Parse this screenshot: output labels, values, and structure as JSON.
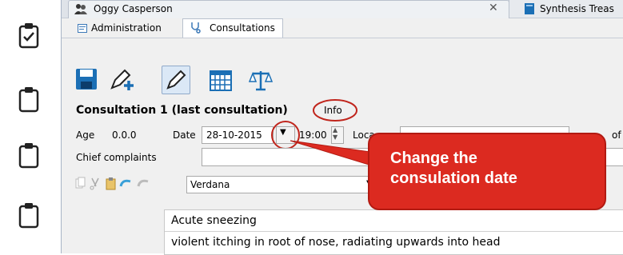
{
  "tabs": {
    "patient": "Oggy Casperson",
    "other": "Synthesis Treas"
  },
  "subtabs": {
    "administration": "Administration",
    "consultations": "Consultations"
  },
  "consultation": {
    "title": "Consultation 1 (last consultation)",
    "info": "Info"
  },
  "fields": {
    "age_label": "Age",
    "age_value": "0.0.0",
    "date_label": "Date",
    "date_value": "28-10-2015",
    "time_value": "19:00",
    "location_label": "Loca",
    "right_label": "of",
    "chief_label": "Chief complaints"
  },
  "format": {
    "font": "Verdana"
  },
  "annotation": {
    "line1": "Change the",
    "line2": "consulation date"
  },
  "notes": [
    "Acute sneezing",
    "violent itching in root of nose, radiating upwards into head"
  ],
  "colors": {
    "accent": "#1b6fb5",
    "callout": "#dc2a20",
    "ring": "#c0251c"
  }
}
